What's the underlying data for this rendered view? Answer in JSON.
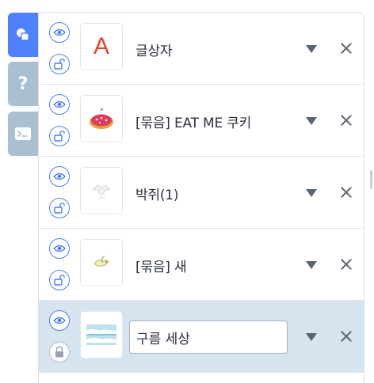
{
  "side_tabs": [
    {
      "icon": "shapes-icon",
      "active": true
    },
    {
      "icon": "help-icon",
      "glyph": "?",
      "active": false
    },
    {
      "icon": "console-icon",
      "active": false
    }
  ],
  "objects": [
    {
      "name": "글상자",
      "visible": true,
      "locked": false,
      "thumb": "text-a"
    },
    {
      "name": "[묶음] EAT ME 쿠키",
      "visible": true,
      "locked": false,
      "thumb": "cookie"
    },
    {
      "name": "박쥐(1)",
      "visible": true,
      "locked": false,
      "thumb": "bat"
    },
    {
      "name": "[묶음] 새",
      "visible": true,
      "locked": false,
      "thumb": "bird"
    },
    {
      "name": "구름 세상",
      "visible": true,
      "locked": true,
      "thumb": "clouds",
      "editing": true
    }
  ],
  "thumb_letter": "A",
  "colors": {
    "accent": "#4f80ff",
    "tab_inactive": "#a9c0d2",
    "selected_row": "#d6e4f0",
    "letter_red": "#e8432e"
  }
}
